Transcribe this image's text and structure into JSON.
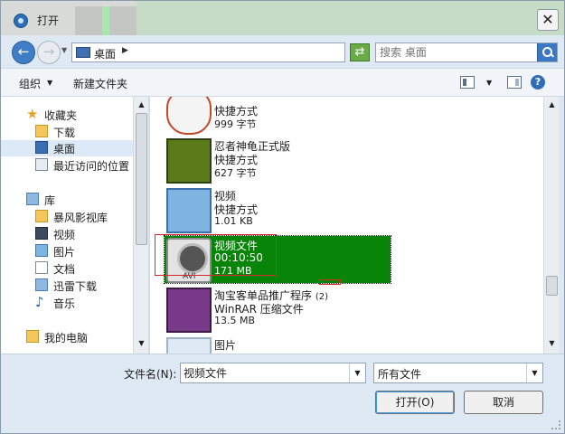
{
  "window": {
    "title": "打开"
  },
  "address": {
    "location": "桌面",
    "search_placeholder": "搜索 桌面"
  },
  "toolbar": {
    "organize_label": "组织",
    "new_folder_label": "新建文件夹"
  },
  "nav": {
    "favorites": {
      "label": "收藏夹",
      "icon": "star-icon"
    },
    "downloads": {
      "label": "下载",
      "icon": "download-folder-icon"
    },
    "desktop": {
      "label": "桌面",
      "icon": "desktop-icon"
    },
    "recent": {
      "label": "最近访问的位置",
      "icon": "recent-places-icon"
    },
    "libraries": {
      "label": "库",
      "icon": "library-icon"
    },
    "storm": {
      "label": "暴风影视库",
      "icon": "folder-icon"
    },
    "video": {
      "label": "视频",
      "icon": "video-library-icon"
    },
    "pictures": {
      "label": "图片",
      "icon": "pictures-library-icon"
    },
    "documents": {
      "label": "文档",
      "icon": "documents-library-icon"
    },
    "xunlei": {
      "label": "迅雷下载",
      "icon": "xunlei-download-icon"
    },
    "music": {
      "label": "音乐",
      "icon": "music-icon"
    },
    "computer": {
      "label": "我的电脑",
      "icon": "computer-icon"
    }
  },
  "files": {
    "row1": {
      "type": "快捷方式",
      "size": "999 字节"
    },
    "row2": {
      "name": "忍者神龟正式版",
      "type": "快捷方式",
      "size": "627 字节"
    },
    "row3": {
      "name": "视频",
      "type": "快捷方式",
      "size": "1.01 KB"
    },
    "row4": {
      "name": "视频文件",
      "type": "00:10:50",
      "size": "171 MB",
      "tag": "AVI"
    },
    "row5": {
      "name": "淘宝客单品推广程序",
      "badge": "(2)",
      "type": "WinRAR 压缩文件",
      "size": "13.5 MB"
    },
    "row6": {
      "name": "图片"
    }
  },
  "bottom": {
    "filename_label": "文件名(N):",
    "filename_value": "视频文件",
    "filetype_value": "所有文件",
    "open_label": "打开(O)",
    "cancel_label": "取消"
  },
  "colors": {
    "selection": "#088408",
    "accent": "#3b78c3",
    "highlight_box": "#d62828"
  }
}
